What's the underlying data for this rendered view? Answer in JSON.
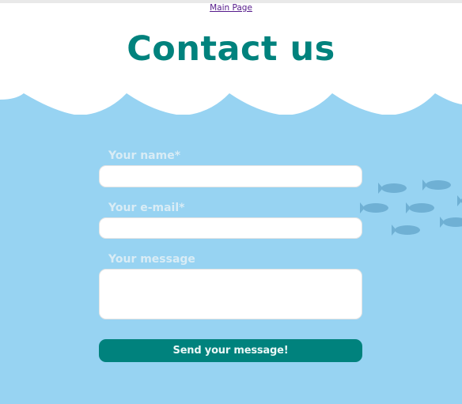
{
  "header": {
    "main_link": "Main Page",
    "title": "Contact us"
  },
  "form": {
    "name_label": "Your name*",
    "email_label": "Your e-mail*",
    "message_label": "Your message",
    "name_value": "",
    "email_value": "",
    "message_value": "",
    "submit_label": "Send your message!"
  },
  "decor": {
    "waves": "wave-border",
    "fish": "fish-icon",
    "fish_count": 7
  },
  "colors": {
    "accent": "#00827d",
    "sea": "#97d3f2",
    "fish": "#6fb0d4",
    "label": "#d9ecf5",
    "link": "#551a8b"
  }
}
